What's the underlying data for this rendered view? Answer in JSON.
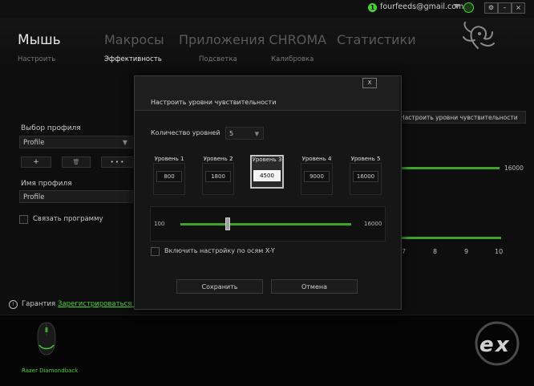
{
  "account": {
    "email": "fourfeeds@gmail.com",
    "badge": "1"
  },
  "window_controls": [
    "⚙",
    "–",
    "×"
  ],
  "main_tabs": [
    "Мышь",
    "Макросы",
    "Приложения CHROMA",
    "Статистики"
  ],
  "sub_tabs": [
    "Настроить",
    "Эффективность",
    "Подсветка",
    "Калибровка"
  ],
  "left_panel": {
    "profile_label": "Выбор профиля",
    "profile_value": "Profile",
    "btn_add": "+",
    "btn_delete": "🗑",
    "btn_more": "• • •",
    "profile_name_label": "Имя профиля",
    "profile_name_value": "Profile",
    "link_program_label": "Связать программу"
  },
  "right_panel": {
    "dropdown_label": "Настроить уровни чувствительности",
    "slider_max": "16000",
    "ticks": [
      "7",
      "8",
      "9",
      "10"
    ]
  },
  "warranty": {
    "label": "Гарантия",
    "link": "Зарегистрироваться се"
  },
  "device": {
    "name": "Razer Diamondback"
  },
  "modal": {
    "title": "Настроить уровни чувствительности",
    "close": "X",
    "levels_label": "Количество уровней",
    "levels_value": "5",
    "stages": [
      {
        "label": "Уровень 1",
        "value": "800",
        "active": false
      },
      {
        "label": "Уровень 2",
        "value": "1800",
        "active": false
      },
      {
        "label": "Уровень 3",
        "value": "4500",
        "active": true
      },
      {
        "label": "Уровень 4",
        "value": "9000",
        "active": false
      },
      {
        "label": "Уровень 5",
        "value": "16000",
        "active": false
      }
    ],
    "slider_min": "100",
    "slider_max": "16000",
    "slider_value": 4500,
    "xy_label": "Включить настройку по осям X-Y",
    "save_label": "Сохранить",
    "cancel_label": "Отмена"
  },
  "colors": {
    "accent": "#44d62c",
    "bar": "#3fa52a"
  }
}
